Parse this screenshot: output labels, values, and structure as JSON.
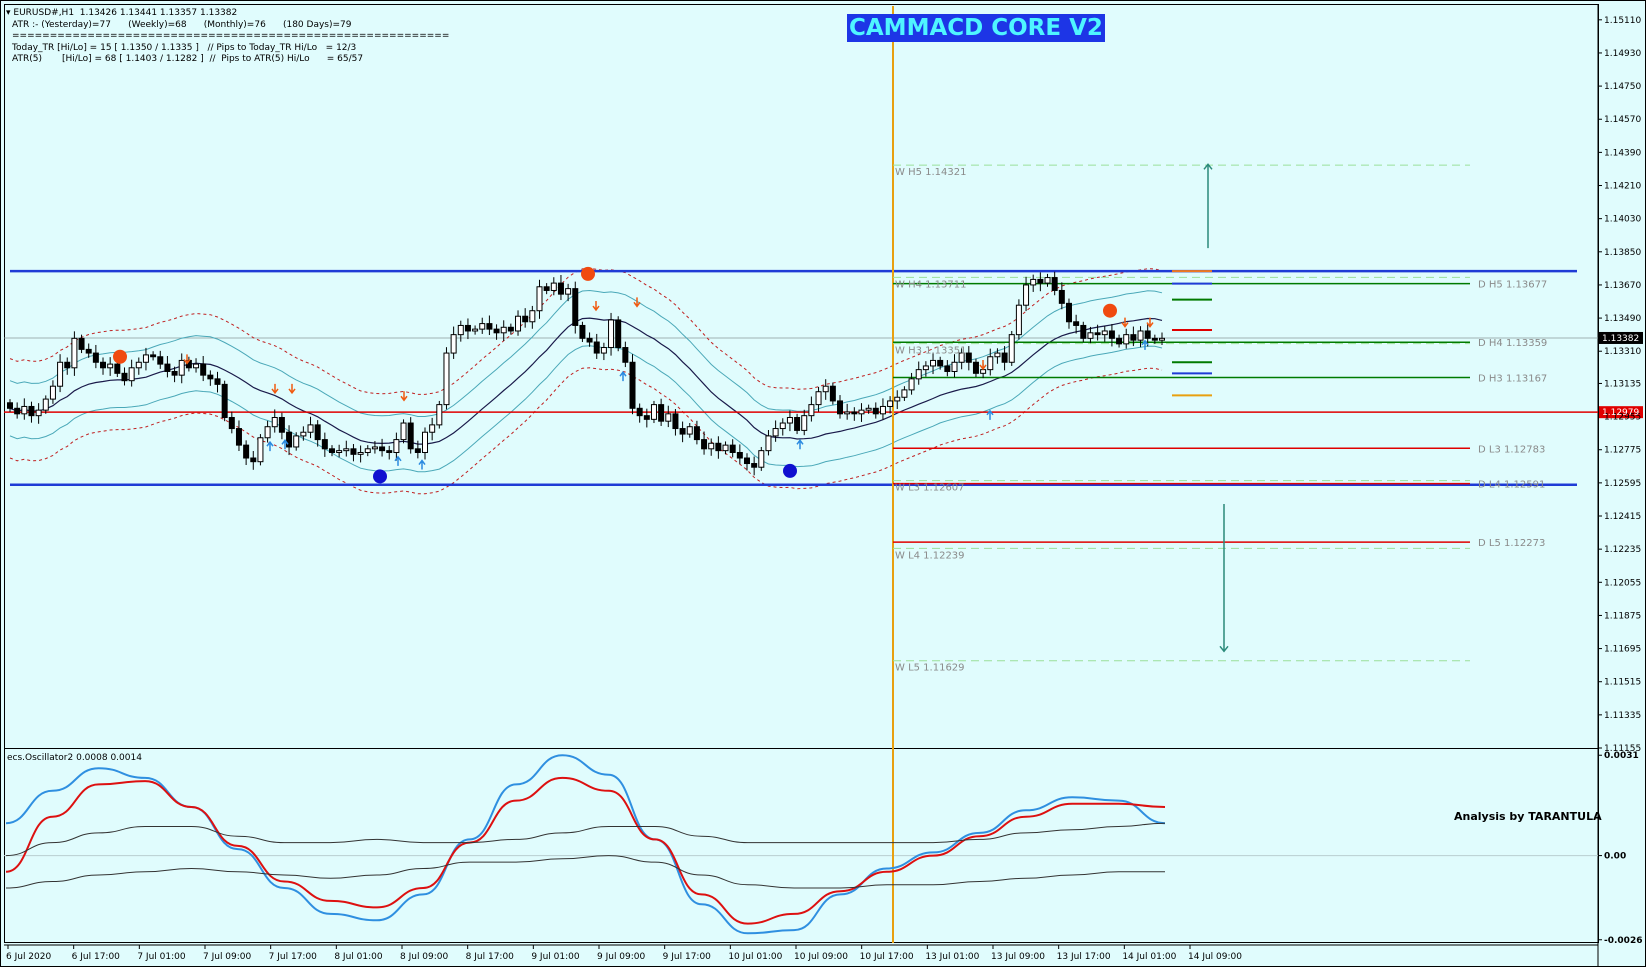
{
  "header": {
    "symbol_line": "EURUSD#,H1  1.13426 1.13441 1.13357 1.13382",
    "atr_line": "ATR :- (Yesterday)=77      (Weekly)=68      (Monthly)=76      (180 Days)=79",
    "separator": "==========================================================",
    "today_tr_line": "Today_TR [Hi/Lo] = 15 [ 1.1350 / 1.1335 ]   // Pips to Today_TR Hi/Lo   = 12/3",
    "atr5_line": "ATR(5)       [Hi/Lo] = 68 [ 1.1403 / 1.1282 ]  //  Pips to ATR(5) Hi/Lo      = 65/57"
  },
  "banner": "CAMMACD CORE V2",
  "signature": "Analysis by TARANTULA",
  "oscillator_label": "ecs.Oscillator2 0.0008 0.0014",
  "colors": {
    "background": "#e0fcfd",
    "candle": "#000000",
    "blue_band": "#1f3bd6",
    "red_level": "#e00000",
    "green_level": "#007a00",
    "orange_vline": "#e8a010",
    "bollinger": "#4aa8b8",
    "osc_blue": "#2f8fe0",
    "osc_red": "#dd1010"
  },
  "chart_data": [
    {
      "type": "candlestick",
      "symbol": "EURUSD#",
      "timeframe": "H1",
      "ohlc": {
        "open": 1.13426,
        "high": 1.13441,
        "low": 1.13357,
        "close": 1.13382
      },
      "ylim": [
        1.11155,
        1.15185
      ],
      "y_ticks": [
        "1.15110",
        "1.14930",
        "1.14750",
        "1.14570",
        "1.14390",
        "1.14210",
        "1.14030",
        "1.13850",
        "1.13670",
        "1.13490",
        "1.13310",
        "1.13135",
        "1.12955",
        "1.12775",
        "1.12595",
        "1.12415",
        "1.12235",
        "1.12055",
        "1.11875",
        "1.11695",
        "1.11515",
        "1.11335",
        "1.11155"
      ],
      "x_labels": [
        "6 Jul 2020",
        "6 Jul 17:00",
        "7 Jul 01:00",
        "7 Jul 09:00",
        "7 Jul 17:00",
        "8 Jul 01:00",
        "8 Jul 09:00",
        "8 Jul 17:00",
        "9 Jul 01:00",
        "9 Jul 09:00",
        "9 Jul 17:00",
        "10 Jul 01:00",
        "10 Jul 09:00",
        "10 Jul 17:00",
        "13 Jul 01:00",
        "13 Jul 09:00",
        "13 Jul 17:00",
        "14 Jul 01:00",
        "14 Jul 09:00"
      ],
      "current_price": 1.13382,
      "red_line_price": 1.12979,
      "candles_close": [
        1.13,
        1.1297,
        1.1301,
        1.1296,
        1.1299,
        1.1305,
        1.1312,
        1.1325,
        1.1322,
        1.1338,
        1.1332,
        1.133,
        1.1325,
        1.1322,
        1.1324,
        1.1319,
        1.1315,
        1.1322,
        1.1325,
        1.1329,
        1.1328,
        1.1324,
        1.132,
        1.1318,
        1.1326,
        1.1322,
        1.1324,
        1.1318,
        1.1316,
        1.1313,
        1.1295,
        1.1289,
        1.128,
        1.1273,
        1.1271,
        1.1284,
        1.129,
        1.1295,
        1.1287,
        1.1279,
        1.1285,
        1.1287,
        1.1291,
        1.1283,
        1.1278,
        1.1276,
        1.1277,
        1.1278,
        1.1275,
        1.1276,
        1.1278,
        1.1279,
        1.1277,
        1.1276,
        1.1283,
        1.1292,
        1.1278,
        1.1276,
        1.1287,
        1.1291,
        1.1302,
        1.133,
        1.134,
        1.1345,
        1.1342,
        1.1343,
        1.1346,
        1.1343,
        1.1341,
        1.1344,
        1.1342,
        1.135,
        1.1347,
        1.1353,
        1.1366,
        1.1364,
        1.1368,
        1.1362,
        1.1365,
        1.1345,
        1.1338,
        1.1336,
        1.133,
        1.1333,
        1.1348,
        1.1333,
        1.1325,
        1.13,
        1.1296,
        1.1294,
        1.1302,
        1.1293,
        1.1297,
        1.1289,
        1.1286,
        1.129,
        1.1283,
        1.1278,
        1.1281,
        1.1277,
        1.128,
        1.1276,
        1.1273,
        1.127,
        1.1268,
        1.1277,
        1.1285,
        1.1289,
        1.1292,
        1.1295,
        1.1288,
        1.1296,
        1.1302,
        1.1309,
        1.1312,
        1.1304,
        1.1297,
        1.1298,
        1.1297,
        1.1299,
        1.13,
        1.1297,
        1.1301,
        1.1304,
        1.1306,
        1.131,
        1.1316,
        1.1321,
        1.1323,
        1.1326,
        1.1323,
        1.132,
        1.1325,
        1.133,
        1.1325,
        1.1319,
        1.1321,
        1.1328,
        1.133,
        1.1325,
        1.134,
        1.1356,
        1.1367,
        1.137,
        1.1368,
        1.1371,
        1.1364,
        1.1357,
        1.1347,
        1.1345,
        1.1338,
        1.1341,
        1.134,
        1.1342,
        1.1338,
        1.1335,
        1.134,
        1.1337,
        1.1342,
        1.1338,
        1.1337,
        1.1338
      ],
      "series": [
        {
          "name": "bollinger_upper"
        },
        {
          "name": "bollinger_lower"
        },
        {
          "name": "ma"
        },
        {
          "name": "upper_dashed"
        },
        {
          "name": "lower_dashed"
        }
      ],
      "horizontal_bands": [
        1.13745,
        1.12585
      ],
      "weekly_levels": [
        {
          "label": "W  H5 1.14321",
          "value": 1.14321
        },
        {
          "label": "W  H4 1.13711",
          "value": 1.13711
        },
        {
          "label": "W  H3 1.13351",
          "value": 1.13351
        },
        {
          "label": "W  L3 1.12607",
          "value": 1.12607
        },
        {
          "label": "W  L4 1.12239",
          "value": 1.12239
        },
        {
          "label": "W  L5 1.11629",
          "value": 1.11629
        }
      ],
      "daily_levels": [
        {
          "label": "D  H5 1.13677",
          "value": 1.13677,
          "color": "green"
        },
        {
          "label": "D  H4 1.13359",
          "value": 1.13359,
          "color": "green"
        },
        {
          "label": "D  H3 1.13167",
          "value": 1.13167,
          "color": "green"
        },
        {
          "label": "D  L3 1.12783",
          "value": 1.12783,
          "color": "red"
        },
        {
          "label": "D  L4 1.12591",
          "value": 1.12591,
          "color": "red"
        },
        {
          "label": "D  L5 1.12273",
          "value": 1.12273,
          "color": "red"
        }
      ],
      "projection_arrows": [
        {
          "direction": "up",
          "from": 1.1387,
          "to": 1.14325
        },
        {
          "direction": "down",
          "from": 1.1248,
          "to": 1.1168
        }
      ]
    },
    {
      "type": "line",
      "name": "ecs.Oscillator2",
      "values_label": "0.0008 0.0014",
      "y_ticks": [
        "0.0031",
        "0.00",
        "-0.0026"
      ],
      "ylim": [
        -0.0027,
        0.0032
      ],
      "series": [
        {
          "color": "blue",
          "values": [
            0.001,
            0.002,
            0.0027,
            0.0024,
            0.0015,
            0.0002,
            -0.001,
            -0.0018,
            -0.002,
            -0.0012,
            0.0005,
            0.0022,
            0.0031,
            0.0025,
            0.0005,
            -0.0015,
            -0.0024,
            -0.0023,
            -0.0012,
            -0.0004,
            0.0001,
            0.0007,
            0.0014,
            0.0018,
            0.0017,
            0.001
          ]
        },
        {
          "color": "red",
          "values": [
            -0.0005,
            0.0012,
            0.0022,
            0.0023,
            0.0015,
            0.0003,
            -0.0008,
            -0.0014,
            -0.0016,
            -0.001,
            0.0004,
            0.0017,
            0.0024,
            0.002,
            0.0005,
            -0.0012,
            -0.0021,
            -0.0018,
            -0.0011,
            -0.0005,
            0.0,
            0.0006,
            0.0012,
            0.0016,
            0.0016,
            0.0015
          ]
        },
        {
          "color": "black",
          "values": [
            0.0,
            0.0004,
            0.0007,
            0.0009,
            0.0009,
            0.0006,
            0.0004,
            0.0004,
            0.0005,
            0.0004,
            0.0004,
            0.0005,
            0.0007,
            0.0009,
            0.0009,
            0.0006,
            0.0004,
            0.0004,
            0.0004,
            0.0004,
            0.0004,
            0.0005,
            0.0007,
            0.0008,
            0.0009,
            0.001
          ]
        },
        {
          "color": "black",
          "values": [
            -0.001,
            -0.0008,
            -0.0006,
            -0.0005,
            -0.0004,
            -0.0005,
            -0.0006,
            -0.0007,
            -0.0006,
            -0.0004,
            -0.0002,
            -0.0002,
            -0.0001,
            0.0,
            -0.0002,
            -0.0006,
            -0.0009,
            -0.001,
            -0.001,
            -0.0009,
            -0.0009,
            -0.0008,
            -0.0007,
            -0.0006,
            -0.0005,
            -0.0005
          ]
        }
      ]
    }
  ]
}
